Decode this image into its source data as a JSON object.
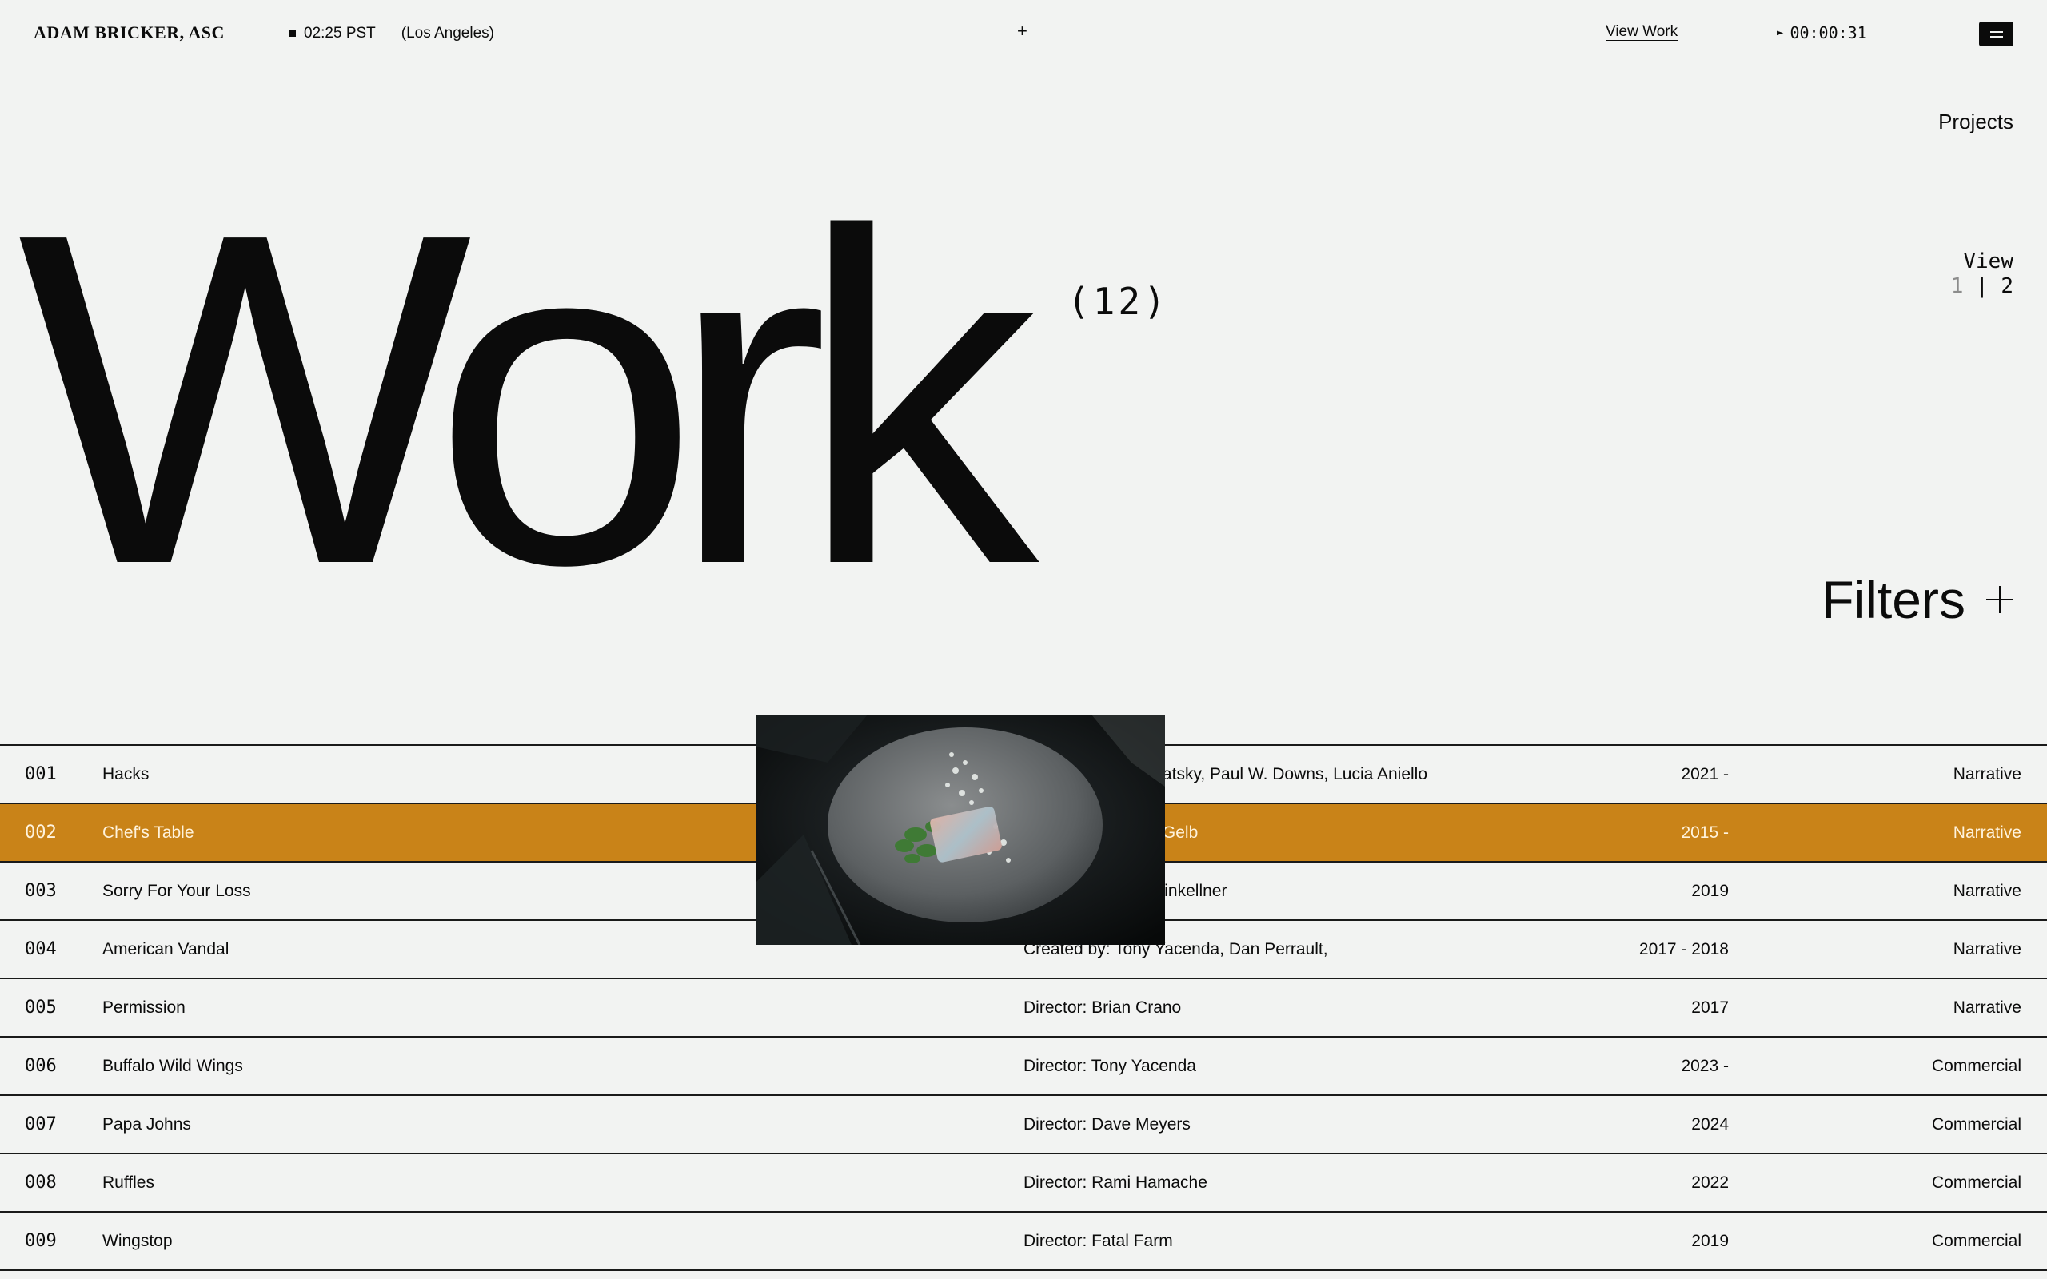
{
  "header": {
    "brand": "ADAM BRICKER, ASC",
    "time": "02:25 PST",
    "location": "(Los Angeles)",
    "center_symbol": "+",
    "view_work_label": "View Work",
    "play_symbol": "►",
    "timer": "00:00:31"
  },
  "side": {
    "projects_label": "Projects",
    "view_label": "View",
    "view_option_1": "1",
    "view_separator": "|",
    "view_option_2": "2",
    "filters_label": "Filters"
  },
  "hero": {
    "title": "Work",
    "count": "(12)"
  },
  "rows": [
    {
      "num": "001",
      "title": "Hacks",
      "credit": "Created by: Jen Statsky, Paul W. Downs, Lucia Aniello",
      "year": "2021 -",
      "category": "Narrative"
    },
    {
      "num": "002",
      "title": "Chef's Table",
      "credit": "Created by: David Gelb",
      "year": "2015 -",
      "category": "Narrative"
    },
    {
      "num": "003",
      "title": "Sorry For Your Loss",
      "credit": "Created by: Kit Steinkellner",
      "year": "2019",
      "category": "Narrative"
    },
    {
      "num": "004",
      "title": "American Vandal",
      "credit": "Created by: Tony Yacenda, Dan Perrault,",
      "year": "2017 - 2018",
      "category": "Narrative"
    },
    {
      "num": "005",
      "title": "Permission",
      "credit": "Director: Brian Crano",
      "year": "2017",
      "category": "Narrative"
    },
    {
      "num": "006",
      "title": "Buffalo Wild Wings",
      "credit": "Director: Tony Yacenda",
      "year": "2023 -",
      "category": "Commercial"
    },
    {
      "num": "007",
      "title": "Papa Johns",
      "credit": "Director: Dave Meyers",
      "year": "2024",
      "category": "Commercial"
    },
    {
      "num": "008",
      "title": "Ruffles",
      "credit": "Director: Rami Hamache",
      "year": "2022",
      "category": "Commercial"
    },
    {
      "num": "009",
      "title": "Wingstop",
      "credit": "Director: Fatal Farm",
      "year": "2019",
      "category": "Commercial"
    }
  ],
  "highlight_color": "#c98318"
}
